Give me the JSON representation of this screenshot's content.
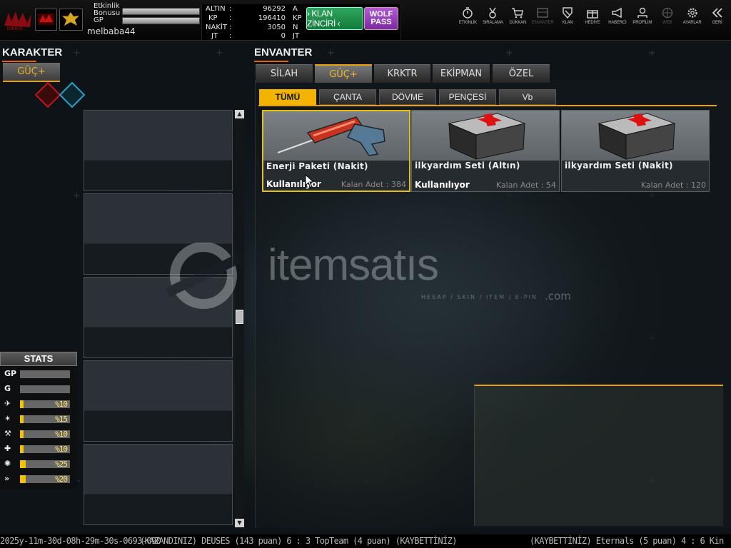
{
  "topbar": {
    "event_bonus_label": "Etkinlik Bonusu",
    "gp_label": "GP",
    "username": "melbaba44",
    "currencies": [
      {
        "label": "ALTIN",
        "value": "96292",
        "unit": "A"
      },
      {
        "label": "KP",
        "value": "196410",
        "unit": "KP"
      },
      {
        "label": "NAKİT",
        "value": "3050",
        "unit": "N"
      },
      {
        "label": "JT",
        "value": "0",
        "unit": "JT"
      }
    ],
    "klan_button": "› KLAN ZİNCİRİ ‹",
    "wolf_button": "WOLF PASS",
    "nav": [
      {
        "icon": "stopwatch-icon",
        "label": "ETKİNLİK"
      },
      {
        "icon": "medal-icon",
        "label": "SIRALAMA"
      },
      {
        "icon": "cart-icon",
        "label": "DÜKKAN"
      },
      {
        "icon": "inventory-icon",
        "label": "ENVANTER"
      },
      {
        "icon": "shield-icon",
        "label": "KLAN"
      },
      {
        "icon": "gift-icon",
        "label": "HEDİYE"
      },
      {
        "icon": "megaphone-icon",
        "label": "HABERCİ"
      },
      {
        "icon": "profile-icon",
        "label": "PROFİLİM"
      },
      {
        "icon": "globe-icon",
        "label": "WEB"
      },
      {
        "icon": "gear-icon",
        "label": "AYARLAR"
      },
      {
        "icon": "back-icon",
        "label": "GERİ"
      }
    ]
  },
  "character": {
    "title": "KARAKTER",
    "tab": "GÜÇ+"
  },
  "stats": {
    "title": "STATS",
    "rows": [
      {
        "icon": "GP",
        "value": "",
        "fill": 0
      },
      {
        "icon": "G",
        "value": "",
        "fill": 0
      },
      {
        "icon": "run-icon",
        "value": "%10",
        "fill": 0.07
      },
      {
        "icon": "dodge-icon",
        "value": "%15",
        "fill": 0.07
      },
      {
        "icon": "ammo-icon",
        "value": "%10",
        "fill": 0.07
      },
      {
        "icon": "heal-icon",
        "value": "%10",
        "fill": 0.07
      },
      {
        "icon": "speed-icon",
        "value": "%25",
        "fill": 0.12
      },
      {
        "icon": "dash-icon",
        "value": "%20",
        "fill": 0.12
      }
    ]
  },
  "inventory": {
    "title": "ENVANTER",
    "tabs": [
      "SİLAH",
      "GÜÇ+",
      "KRKTR",
      "EKİPMAN",
      "ÖZEL"
    ],
    "subtabs": [
      "TÜMÜ",
      "ÇANTA",
      "DÖVME",
      "PENÇESİ",
      "Vb"
    ],
    "items": [
      {
        "name": "Enerji Paketi (Nakit)",
        "status": "Kullanılıyor",
        "remaining": "Kalan Adet : 384"
      },
      {
        "name": "ilkyardım Seti (Altın)",
        "status": "Kullanılıyor",
        "remaining": "Kalan Adet : 54"
      },
      {
        "name": "ilkyardım Seti (Nakit)",
        "status": "",
        "remaining": "Kalan Adet : 120"
      }
    ]
  },
  "watermark": {
    "brand": "itemsatıs",
    "tagline": "HESAP / SKIN / ITEM / E-PIN",
    "suffix": ".com"
  },
  "ticker": {
    "part1": "2025y-11m-30d-08h-29m-30s-0693-090",
    "part2": "(KAZANDINIZ) DEUSES (143 puan) 6 : 3 TopTeam (4 puan) (KAYBETTİNİZ)",
    "part3": "(KAYBETTİNİZ) Eternals (5 puan) 4 : 6 Kin"
  }
}
